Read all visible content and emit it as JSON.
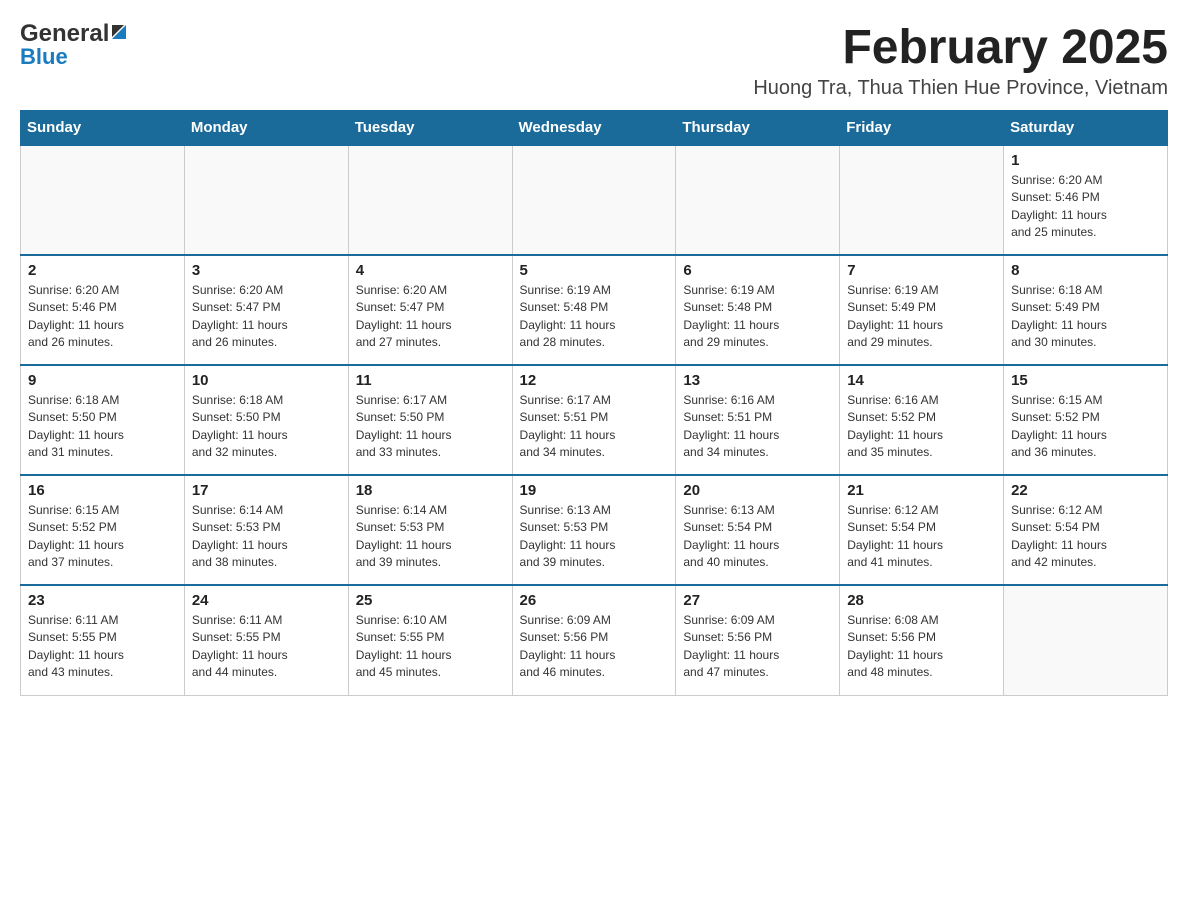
{
  "header": {
    "month_title": "February 2025",
    "location": "Huong Tra, Thua Thien Hue Province, Vietnam",
    "logo_general": "General",
    "logo_blue": "Blue"
  },
  "days_of_week": [
    "Sunday",
    "Monday",
    "Tuesday",
    "Wednesday",
    "Thursday",
    "Friday",
    "Saturday"
  ],
  "weeks": [
    {
      "days": [
        {
          "date": "",
          "info": ""
        },
        {
          "date": "",
          "info": ""
        },
        {
          "date": "",
          "info": ""
        },
        {
          "date": "",
          "info": ""
        },
        {
          "date": "",
          "info": ""
        },
        {
          "date": "",
          "info": ""
        },
        {
          "date": "1",
          "info": "Sunrise: 6:20 AM\nSunset: 5:46 PM\nDaylight: 11 hours\nand 25 minutes."
        }
      ]
    },
    {
      "days": [
        {
          "date": "2",
          "info": "Sunrise: 6:20 AM\nSunset: 5:46 PM\nDaylight: 11 hours\nand 26 minutes."
        },
        {
          "date": "3",
          "info": "Sunrise: 6:20 AM\nSunset: 5:47 PM\nDaylight: 11 hours\nand 26 minutes."
        },
        {
          "date": "4",
          "info": "Sunrise: 6:20 AM\nSunset: 5:47 PM\nDaylight: 11 hours\nand 27 minutes."
        },
        {
          "date": "5",
          "info": "Sunrise: 6:19 AM\nSunset: 5:48 PM\nDaylight: 11 hours\nand 28 minutes."
        },
        {
          "date": "6",
          "info": "Sunrise: 6:19 AM\nSunset: 5:48 PM\nDaylight: 11 hours\nand 29 minutes."
        },
        {
          "date": "7",
          "info": "Sunrise: 6:19 AM\nSunset: 5:49 PM\nDaylight: 11 hours\nand 29 minutes."
        },
        {
          "date": "8",
          "info": "Sunrise: 6:18 AM\nSunset: 5:49 PM\nDaylight: 11 hours\nand 30 minutes."
        }
      ]
    },
    {
      "days": [
        {
          "date": "9",
          "info": "Sunrise: 6:18 AM\nSunset: 5:50 PM\nDaylight: 11 hours\nand 31 minutes."
        },
        {
          "date": "10",
          "info": "Sunrise: 6:18 AM\nSunset: 5:50 PM\nDaylight: 11 hours\nand 32 minutes."
        },
        {
          "date": "11",
          "info": "Sunrise: 6:17 AM\nSunset: 5:50 PM\nDaylight: 11 hours\nand 33 minutes."
        },
        {
          "date": "12",
          "info": "Sunrise: 6:17 AM\nSunset: 5:51 PM\nDaylight: 11 hours\nand 34 minutes."
        },
        {
          "date": "13",
          "info": "Sunrise: 6:16 AM\nSunset: 5:51 PM\nDaylight: 11 hours\nand 34 minutes."
        },
        {
          "date": "14",
          "info": "Sunrise: 6:16 AM\nSunset: 5:52 PM\nDaylight: 11 hours\nand 35 minutes."
        },
        {
          "date": "15",
          "info": "Sunrise: 6:15 AM\nSunset: 5:52 PM\nDaylight: 11 hours\nand 36 minutes."
        }
      ]
    },
    {
      "days": [
        {
          "date": "16",
          "info": "Sunrise: 6:15 AM\nSunset: 5:52 PM\nDaylight: 11 hours\nand 37 minutes."
        },
        {
          "date": "17",
          "info": "Sunrise: 6:14 AM\nSunset: 5:53 PM\nDaylight: 11 hours\nand 38 minutes."
        },
        {
          "date": "18",
          "info": "Sunrise: 6:14 AM\nSunset: 5:53 PM\nDaylight: 11 hours\nand 39 minutes."
        },
        {
          "date": "19",
          "info": "Sunrise: 6:13 AM\nSunset: 5:53 PM\nDaylight: 11 hours\nand 39 minutes."
        },
        {
          "date": "20",
          "info": "Sunrise: 6:13 AM\nSunset: 5:54 PM\nDaylight: 11 hours\nand 40 minutes."
        },
        {
          "date": "21",
          "info": "Sunrise: 6:12 AM\nSunset: 5:54 PM\nDaylight: 11 hours\nand 41 minutes."
        },
        {
          "date": "22",
          "info": "Sunrise: 6:12 AM\nSunset: 5:54 PM\nDaylight: 11 hours\nand 42 minutes."
        }
      ]
    },
    {
      "days": [
        {
          "date": "23",
          "info": "Sunrise: 6:11 AM\nSunset: 5:55 PM\nDaylight: 11 hours\nand 43 minutes."
        },
        {
          "date": "24",
          "info": "Sunrise: 6:11 AM\nSunset: 5:55 PM\nDaylight: 11 hours\nand 44 minutes."
        },
        {
          "date": "25",
          "info": "Sunrise: 6:10 AM\nSunset: 5:55 PM\nDaylight: 11 hours\nand 45 minutes."
        },
        {
          "date": "26",
          "info": "Sunrise: 6:09 AM\nSunset: 5:56 PM\nDaylight: 11 hours\nand 46 minutes."
        },
        {
          "date": "27",
          "info": "Sunrise: 6:09 AM\nSunset: 5:56 PM\nDaylight: 11 hours\nand 47 minutes."
        },
        {
          "date": "28",
          "info": "Sunrise: 6:08 AM\nSunset: 5:56 PM\nDaylight: 11 hours\nand 48 minutes."
        },
        {
          "date": "",
          "info": ""
        }
      ]
    }
  ]
}
